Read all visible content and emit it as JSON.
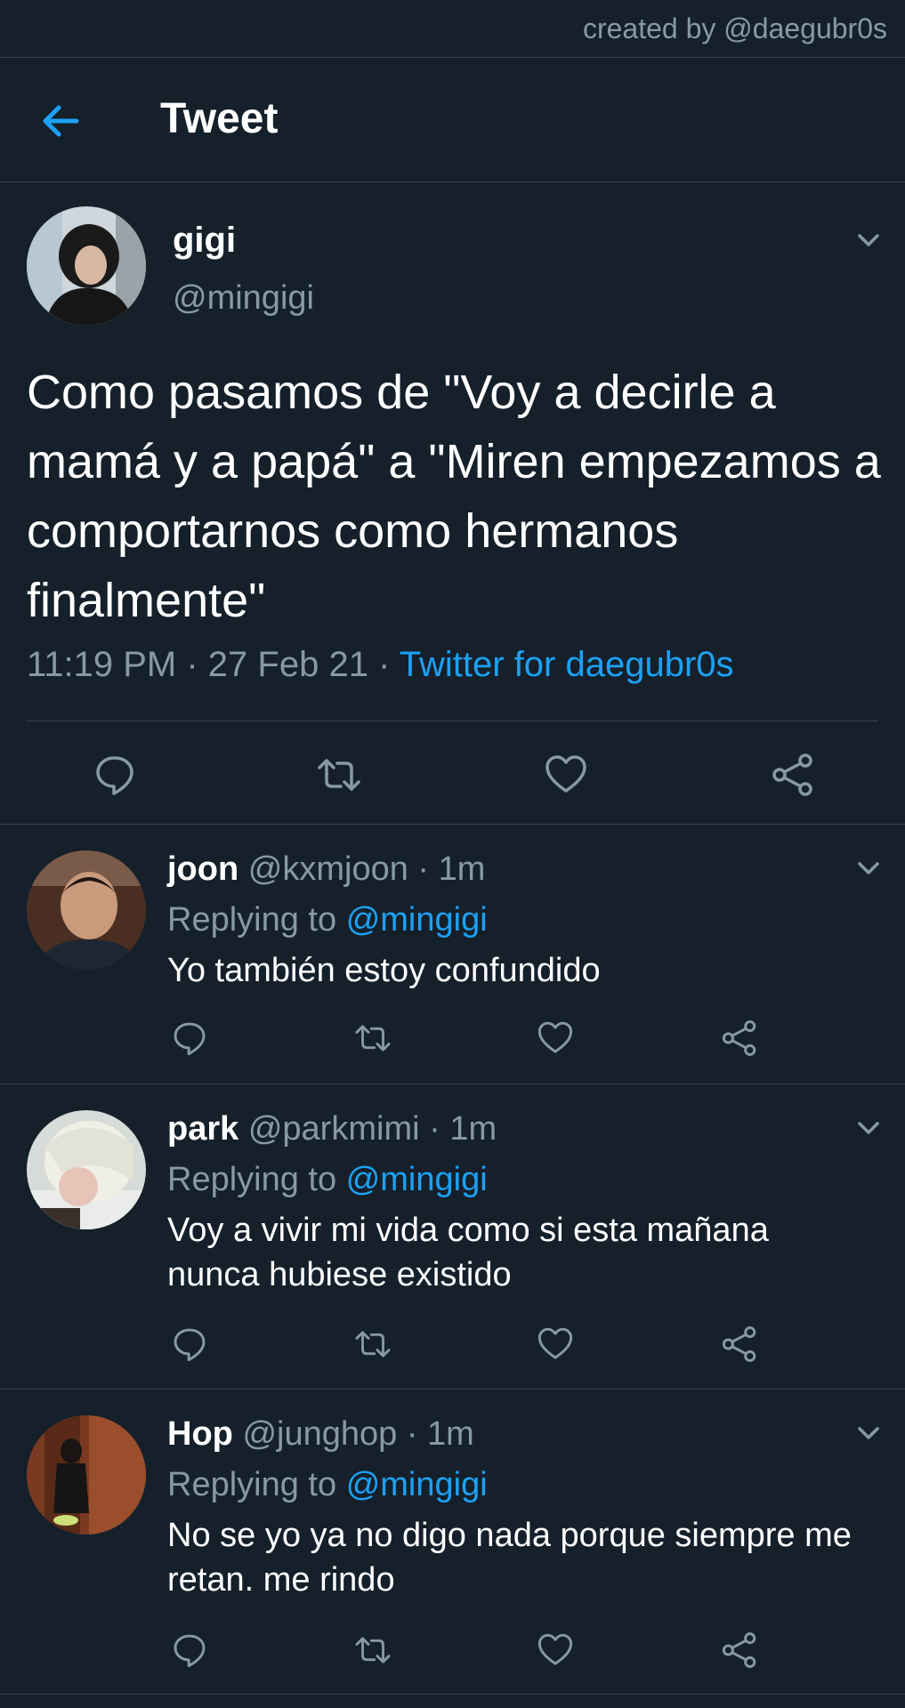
{
  "watermark": "created by @daegubr0s",
  "header": {
    "title": "Tweet",
    "back_icon": "arrow-left-icon"
  },
  "colors": {
    "background": "#15202b",
    "accent": "#1da1f2",
    "muted": "#8899a6",
    "divider": "#38444d"
  },
  "main_tweet": {
    "name": "gigi",
    "handle": "@mingigi",
    "text": "Como pasamos de \"Voy a decirle a mamá y a papá\" a \"Miren empezamos a comportarnos como hermanos finalmente\"",
    "time": "11:19 PM",
    "sep": " · ",
    "date": "27 Feb 21",
    "source": "Twitter for daegubr0s"
  },
  "replies": [
    {
      "name": "joon",
      "handle": "@kxmjoon",
      "time": "1m",
      "replying_label": "Replying to",
      "replying_to": "@mingigi",
      "text": "Yo también estoy confundido"
    },
    {
      "name": "park",
      "handle": "@parkmimi",
      "time": "1m",
      "replying_label": "Replying to",
      "replying_to": "@mingigi",
      "text": "Voy a vivir mi vida como si esta mañana nunca hubiese existido"
    },
    {
      "name": "Hop",
      "handle": "@junghop",
      "time": "1m",
      "replying_label": "Replying to",
      "replying_to": "@mingigi",
      "text": "No se yo ya no digo nada porque siempre me retan. me rindo"
    }
  ]
}
